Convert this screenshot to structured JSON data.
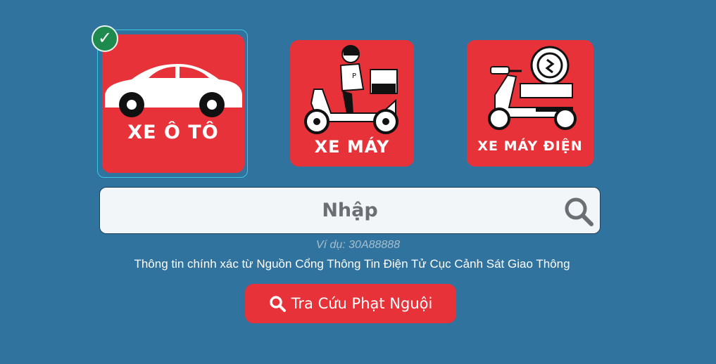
{
  "vehicle_types": [
    {
      "label": "XE Ô TÔ",
      "selected": true
    },
    {
      "label": "XE MÁY",
      "selected": false
    },
    {
      "label": "XE MÁY ĐIỆN",
      "selected": false
    }
  ],
  "search": {
    "placeholder": "Nhập",
    "value": "",
    "example": "Ví dụ: 30A88888"
  },
  "source_note": "Thông tin chính xác từ Nguồn Cổng Thông Tin Điện Tử Cục Cảnh Sát Giao Thông",
  "lookup_button": {
    "label": "Tra Cứu Phạt Nguội",
    "icon": "search-icon"
  },
  "colors": {
    "background": "#2f739e",
    "tile": "#e8323a",
    "selected_border": "#3cc6e6",
    "check_badge": "#1f8a4e",
    "input_bg": "#f3f6f9"
  }
}
